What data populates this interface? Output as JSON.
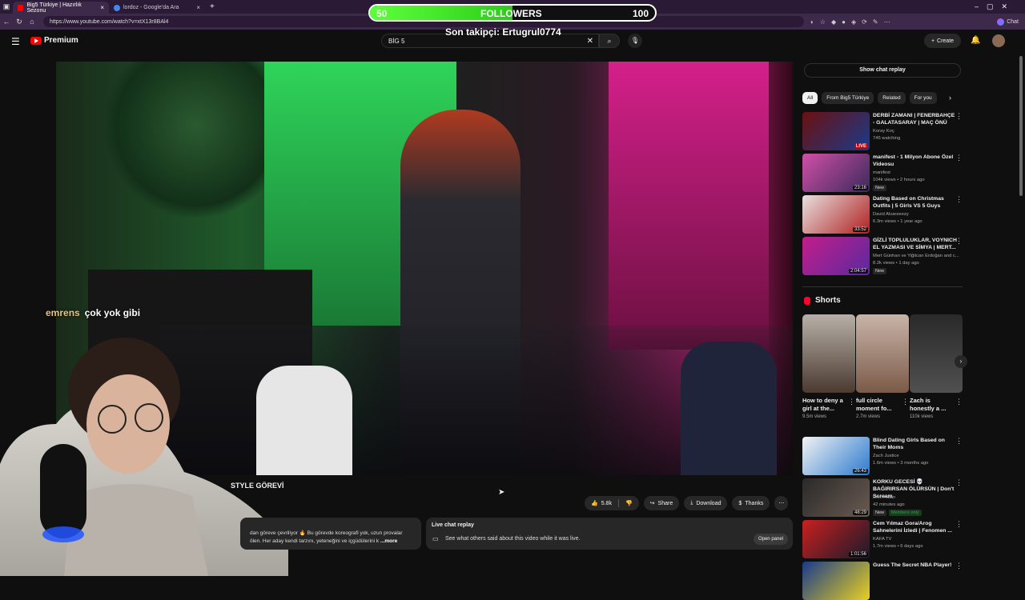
{
  "browser": {
    "tabs": [
      {
        "label": "Big5 Türkiye | Hazırlık Sezonu",
        "active": true
      },
      {
        "label": "lordoz - Google'da Ara",
        "active": false
      }
    ],
    "new_tab": "+",
    "url": "https://www.youtube.com/watch?v=xtX13r8BAl4",
    "chat_label": "Chat"
  },
  "youtube": {
    "brand": "Premium",
    "search_value": "BİG 5",
    "create_label": "Create"
  },
  "stream_overlay": {
    "followers_current": "50",
    "followers_label": "FOLLOWERS",
    "followers_goal": "100",
    "followers_progress": 0.5,
    "last_follower": "Son takipçi: Ertugrul0774",
    "chat_user": "emrens",
    "chat_message": "çok yok gibi"
  },
  "video": {
    "title": "STYLE GÖREVİ",
    "likes": "5.8k",
    "share_label": "Share",
    "download_label": "Download",
    "thanks_label": "Thanks",
    "description_line1": "dan göreve çevriliyor 🔥 Bu görevde koreografi yok, uzun provalar",
    "description_line2": "ölen. Her aday kendi tarzını, yeteneğini ve içgüdülerini k",
    "description_more": "...more",
    "live_chat_header": "Live chat replay",
    "live_chat_body": "See what others said about this video while it was live.",
    "open_panel": "Open panel"
  },
  "sidebar": {
    "show_chat_replay": "Show chat replay",
    "chips": [
      "All",
      "From Big5 Türkiye",
      "Related",
      "For you"
    ],
    "recommendations_top": [
      {
        "title": "DERBİ ZAMANI | FENERBAHÇE - GALATASARAY | MAÇ ÖNÜ",
        "channel": "Koray Koç",
        "meta": "745 watching",
        "badge": "LIVE",
        "colors": [
          "#6b1010",
          "#1a3a8a"
        ]
      },
      {
        "title": "manifest - 1 Milyon Abone Özel Videosu",
        "channel": "manifest",
        "meta": "104k views • 2 hours ago",
        "duration": "23:16",
        "new": "New",
        "colors": [
          "#d14fa8",
          "#3a2a5a"
        ]
      },
      {
        "title": "Dating Based on Christmas Outfits | 5 Girls VS 5 Guys",
        "channel": "David Alvareeezy",
        "meta": "6.3m views • 1 year ago",
        "duration": "33:52",
        "colors": [
          "#e8e0e0",
          "#b02020"
        ]
      },
      {
        "title": "GİZLİ TOPLULUKLAR, VOYNICH EL YAZMASI VE SİMYA | MERT...",
        "channel": "Mert Günhan ve Yiğitcan Erdoğan and c...",
        "meta": "8.2k views • 1 day ago",
        "duration": "2:04:57",
        "new": "New",
        "colors": [
          "#c21d8a",
          "#5a2aa0"
        ]
      }
    ],
    "shorts_title": "Shorts",
    "shorts": [
      {
        "title": "How to deny a girl at the...",
        "views": "9.5m views",
        "colors": [
          "#b8b0a8",
          "#4a3a30"
        ]
      },
      {
        "title": "full circle moment fo...",
        "views": "2.7m views",
        "colors": [
          "#c8b4a8",
          "#7a5a48"
        ]
      },
      {
        "title": "Zach is honestly a ...",
        "views": "110k views",
        "colors": [
          "#2a2a2a",
          "#505050"
        ]
      }
    ],
    "recommendations_bottom": [
      {
        "title": "Blind Dating Girls Based on Their Moms",
        "channel": "Zach Justice",
        "meta": "1.6m views • 3 months ago",
        "duration": "26:43",
        "colors": [
          "#f2f2f2",
          "#2a7ad0"
        ]
      },
      {
        "title": "KORKU GECESİ 💀 BAĞIRIRSAN ÖLÜRSÜN | Don't Scream",
        "channel": "Eren Aktan",
        "meta": "42 minutes ago",
        "duration": "48:29",
        "new": "New",
        "members": "Members only",
        "colors": [
          "#2a2a2a",
          "#6a5a50"
        ]
      },
      {
        "title": "Cem Yılmaz Gora/Arog Sahnelerini İzledi | Fenomen ...",
        "channel": "KAFA TV",
        "meta": "1.7m views • 6 days ago",
        "duration": "1:01:56",
        "colors": [
          "#c82020",
          "#1a1a2a"
        ]
      },
      {
        "title": "Guess The Secret NBA Player!",
        "channel": "",
        "meta": "",
        "colors": [
          "#1a3a8a",
          "#e8d020"
        ]
      }
    ]
  }
}
